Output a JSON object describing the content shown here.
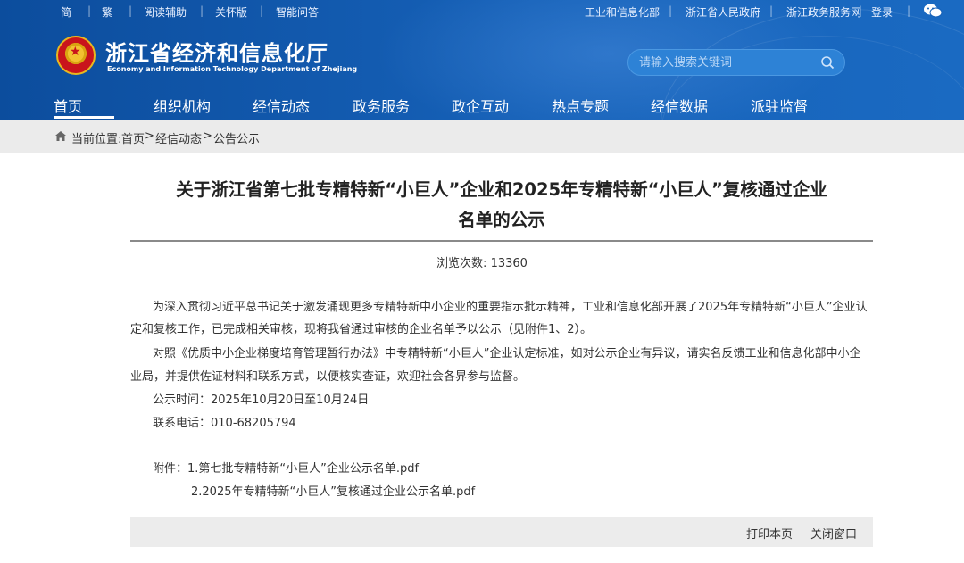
{
  "topbar": {
    "left": [
      "简",
      "繁",
      "阅读辅助",
      "关怀版",
      "智能问答"
    ],
    "right": [
      "工业和信息化部",
      "浙江省人民政府",
      "浙江政务服务网",
      "登录"
    ]
  },
  "logo": {
    "cn": "浙江省经济和信息化厅",
    "en": "Economy and Information Technology Department of Zhejiang"
  },
  "search": {
    "placeholder": "请输入搜索关键词"
  },
  "nav": [
    "首页",
    "组织机构",
    "经信动态",
    "政务服务",
    "政企互动",
    "热点专题",
    "经信数据",
    "派驻监督"
  ],
  "breadcrumb": {
    "prefix": "当前位置:",
    "items": [
      "首页",
      "经信动态",
      "公告公示"
    ],
    "sep": ">"
  },
  "article": {
    "title_line1": "关于浙江省第七批专精特新“小巨人”企业和2025年专精特新“小巨人”复核通过企业",
    "title_line2": "名单的公示",
    "views_label": "浏览次数:",
    "views": "13360",
    "p1_line1": "为深入贯彻习近平总书记关于激发涌现更多专精特新中小企业的重要指示批示精神，工业和信息化部开展了2025年专精特新“小巨人”企业认",
    "p1_line2": "定和复核工作，已完成相关审核，现将我省通过审核的企业名单予以公示（见附件1、2）。",
    "p2_line1": "对照《优质中小企业梯度培育管理暂行办法》中专精特新“小巨人”企业认定标准，如对公示企业有异议，请实名反馈工业和信息化部中小企",
    "p2_line2": "业局，并提供佐证材料和联系方式，以便核实查证，欢迎社会各界参与监督。",
    "period": "公示时间：2025年10月20日至10月24日",
    "phone": "联系电话：010-68205794",
    "attach1": "附件：1.第七批专精特新“小巨人”企业公示名单.pdf",
    "attach2": "2.2025年专精特新“小巨人”复核通过企业公示名单.pdf"
  },
  "footer": {
    "print": "打印本页",
    "close": "关闭窗口"
  },
  "colors": {
    "header": "#1661b8",
    "crumb_bg": "#ebebeb"
  }
}
